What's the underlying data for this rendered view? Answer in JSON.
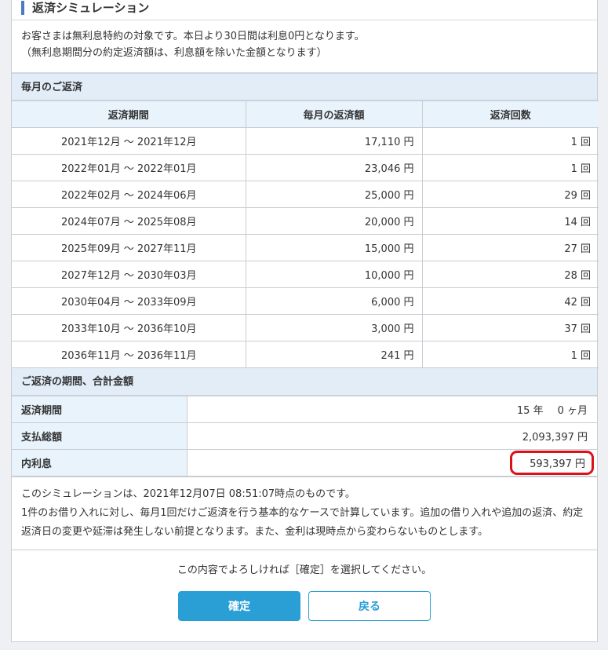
{
  "header": {
    "title": "返済シミュレーション"
  },
  "notice": {
    "line1": "お客さまは無利息特約の対象です。本日より30日間は利息0円となります。",
    "line2": "（無利息期間分の約定返済額は、利息額を除いた金額となります）"
  },
  "monthly": {
    "section_title": "毎月のご返済",
    "columns": [
      "返済期間",
      "毎月の返済額",
      "返済回数"
    ],
    "rows": [
      {
        "period": "2021年12月 ～ 2021年12月",
        "amount": "17,110 円",
        "count": "1 回"
      },
      {
        "period": "2022年01月 ～ 2022年01月",
        "amount": "23,046 円",
        "count": "1 回"
      },
      {
        "period": "2022年02月 ～ 2024年06月",
        "amount": "25,000 円",
        "count": "29 回"
      },
      {
        "period": "2024年07月 ～ 2025年08月",
        "amount": "20,000 円",
        "count": "14 回"
      },
      {
        "period": "2025年09月 ～ 2027年11月",
        "amount": "15,000 円",
        "count": "27 回"
      },
      {
        "period": "2027年12月 ～ 2030年03月",
        "amount": "10,000 円",
        "count": "28 回"
      },
      {
        "period": "2030年04月 ～ 2033年09月",
        "amount": "6,000 円",
        "count": "42 回"
      },
      {
        "period": "2033年10月 ～ 2036年10月",
        "amount": "3,000 円",
        "count": "37 回"
      },
      {
        "period": "2036年11月 ～ 2036年11月",
        "amount": "241 円",
        "count": "1 回"
      }
    ]
  },
  "summary": {
    "section_title": "ご返済の期間、合計金額",
    "period_label": "返済期間",
    "period_years": "15 年",
    "period_months": "0 ヶ月",
    "total_label": "支払総額",
    "total_value": "2,093,397 円",
    "interest_label": "内利息",
    "interest_value": "593,397 円"
  },
  "footnote": {
    "line1": "このシミュレーションは、2021年12月07日 08:51:07時点のものです。",
    "line2": "1件のお借り入れに対し、毎月1回だけご返済を行う基本的なケースで計算しています。追加の借り入れや追加の返済、約定返済日の変更や延滞は発生しない前提となります。また、金利は現時点から変わらないものとします。"
  },
  "confirm": {
    "message": "この内容でよろしければ［確定］を選択してください。",
    "confirm_label": "確定",
    "back_label": "戻る"
  },
  "colors": {
    "accent": "#4a7dbf",
    "button": "#2a9fd6",
    "highlight": "#d9121b",
    "header_bg": "#e2edf8"
  }
}
